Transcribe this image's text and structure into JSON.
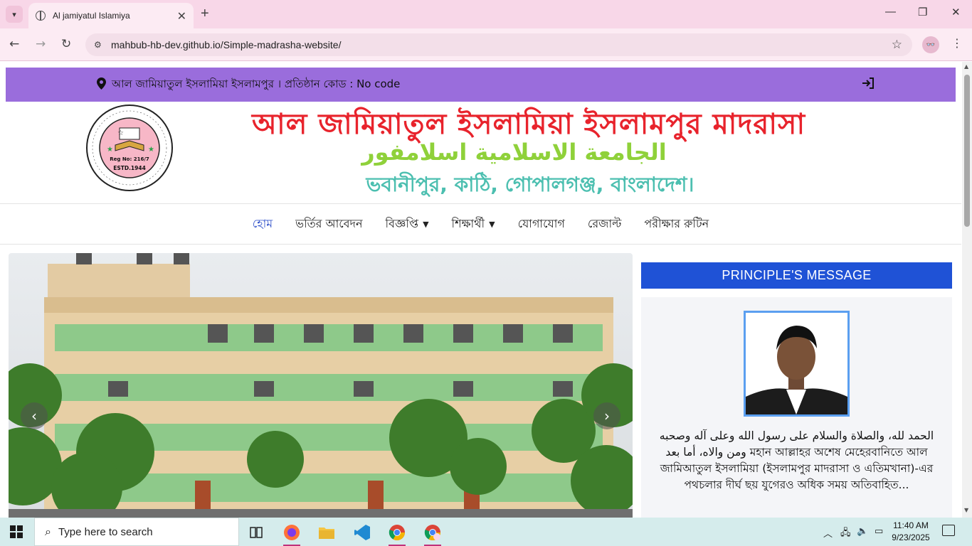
{
  "browser": {
    "tab_title": "Al jamiyatul Islamiya",
    "url": "mahbub-hb-dev.github.io/Simple-madrasha-website/",
    "new_tab_symbol": "+",
    "close_symbol": "✕"
  },
  "topbar": {
    "address_text": "আল জামিয়াতুল ইসলামিয়া ইসলামপুর । প্রতিষ্ঠান কোড : No code",
    "icons": [
      "location-pin-icon",
      "login-icon"
    ]
  },
  "banner": {
    "title": "আল জামিয়াতুল ইসলামিয়া ইসলামপুর মাদরাসা",
    "subtitle_arabic": "الجامعة الاسلامية اسلامفور",
    "address": "ভবানীপুর, কাঠি, গোপালগঞ্জ, বাংলাদেশ।",
    "logo": {
      "reg_no": "Reg No: 216/7",
      "estd": "ESTD.1944"
    }
  },
  "nav": {
    "items": [
      {
        "label": "হোম",
        "active": true,
        "dropdown": false
      },
      {
        "label": "ভর্তির আবেদন",
        "active": false,
        "dropdown": false
      },
      {
        "label": "বিজ্ঞপ্তি",
        "active": false,
        "dropdown": true
      },
      {
        "label": "শিক্ষার্থী",
        "active": false,
        "dropdown": true
      },
      {
        "label": "যোগাযোগ",
        "active": false,
        "dropdown": false
      },
      {
        "label": "রেজাল্ট",
        "active": false,
        "dropdown": false
      },
      {
        "label": "পরীক্ষার রুটিন",
        "active": false,
        "dropdown": false
      }
    ]
  },
  "sidebar": {
    "heading": "PRINCIPLE'S MESSAGE",
    "message": "الحمد لله، والصلاة والسلام على رسول الله وعلى آله وصحبه ومن والاه، أما بعد মহান আল্লাহর অশেষ মেহেরবানিতে আল জামিআতুল ইসলামিয়া (ইসলামপুর মাদরাসা ও এতিমখানা)-এর পথচলার দীর্ঘ ছয় যুগেরও অধিক সময় অতিবাহিত..."
  },
  "taskbar": {
    "search_placeholder": "Type here to search",
    "time": "11:40 AM",
    "date": "9/23/2025",
    "apps": [
      "task-view-icon",
      "firefox-icon",
      "file-explorer-icon",
      "vscode-icon",
      "chrome-icon",
      "chrome-profile-icon"
    ]
  },
  "colors": {
    "topbar_bg": "#9a6ddc",
    "title_red": "#e8232c",
    "arabic_green": "#8fd13a",
    "address_teal": "#4cbfb0",
    "nav_active": "#2e4fc9",
    "sidebar_head": "#1f52d6"
  }
}
